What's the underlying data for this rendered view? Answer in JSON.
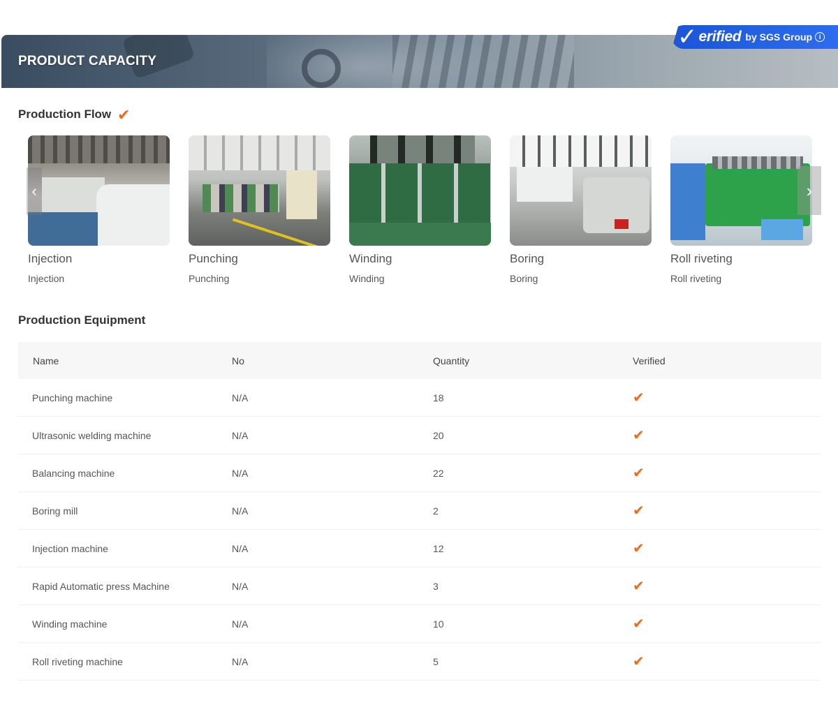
{
  "banner": {
    "title": "PRODUCT CAPACITY"
  },
  "badge": {
    "mark": "✓",
    "word": "erified",
    "by": "by SGS Group",
    "info": "i",
    "colors": {
      "background": "#1b55d9",
      "text": "#ffffff"
    }
  },
  "flow": {
    "title": "Production Flow",
    "check": "✔",
    "items": [
      {
        "label": "Injection",
        "sub": "Injection"
      },
      {
        "label": "Punching",
        "sub": "Punching"
      },
      {
        "label": "Winding",
        "sub": "Winding"
      },
      {
        "label": "Boring",
        "sub": "Boring"
      },
      {
        "label": "Roll riveting",
        "sub": "Roll riveting"
      }
    ],
    "prev_arrow": "‹",
    "next_arrow": "›"
  },
  "equipment": {
    "title": "Production Equipment",
    "headers": {
      "name": "Name",
      "no": "No",
      "quantity": "Quantity",
      "verified": "Verified"
    },
    "check": "✔",
    "rows": [
      {
        "name": "Punching machine",
        "no": "N/A",
        "quantity": "18"
      },
      {
        "name": "Ultrasonic welding machine",
        "no": "N/A",
        "quantity": "20"
      },
      {
        "name": "Balancing machine",
        "no": "N/A",
        "quantity": "22"
      },
      {
        "name": "Boring mill",
        "no": "N/A",
        "quantity": "2"
      },
      {
        "name": "Injection machine",
        "no": "N/A",
        "quantity": "12"
      },
      {
        "name": "Rapid Automatic press Machine",
        "no": "N/A",
        "quantity": "3"
      },
      {
        "name": "Winding machine",
        "no": "N/A",
        "quantity": "10"
      },
      {
        "name": "Roll riveting machine",
        "no": "N/A",
        "quantity": "5"
      }
    ]
  },
  "colors": {
    "accent_check": "#f06a1a",
    "badge_blue": "#1b55d9",
    "header_bg": "#f7f7f7"
  }
}
